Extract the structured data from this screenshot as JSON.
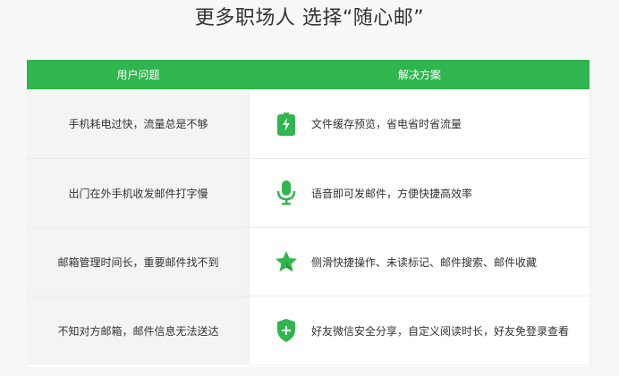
{
  "page": {
    "title": "更多职场人 选择“随心邮”"
  },
  "table": {
    "headers": {
      "problem": "用户问题",
      "solution": "解决方案"
    },
    "rows": [
      {
        "problem": "手机耗电过快，流量总是不够",
        "solution": "文件缓存预览，省电省时省流量",
        "icon": "battery-icon"
      },
      {
        "problem": "出门在外手机收发邮件打字慢",
        "solution": "语音即可发邮件，方便快捷高效率",
        "icon": "microphone-icon"
      },
      {
        "problem": "邮箱管理时间长，重要邮件找不到",
        "solution": "侧滑快捷操作、未读标记、邮件搜索、邮件收藏",
        "icon": "star-icon"
      },
      {
        "problem": "不知对方邮箱，邮件信息无法送达",
        "solution": "好友微信安全分享，自定义阅读时长，好友免登录查看",
        "icon": "shield-plus-icon"
      }
    ]
  },
  "colors": {
    "accent": "#2fb64e",
    "problem_bg": "#f4f4f4",
    "page_bg": "#f7f7f7"
  }
}
